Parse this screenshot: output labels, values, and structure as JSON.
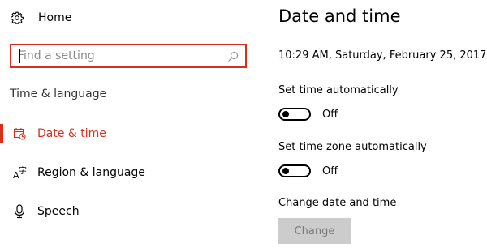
{
  "nav": {
    "home_label": "Home",
    "search": {
      "value": "",
      "placeholder": "Find a setting"
    },
    "section_title": "Time & language",
    "items": [
      {
        "label": "Date & time",
        "icon": "calendar-clock-icon",
        "active": true
      },
      {
        "label": "Region & language",
        "icon": "language-icon",
        "active": false
      },
      {
        "label": "Speech",
        "icon": "microphone-icon",
        "active": false
      }
    ]
  },
  "main": {
    "title": "Date and time",
    "current_datetime": "10:29 AM, Saturday, February 25, 2017",
    "set_time_auto": {
      "label": "Set time automatically",
      "state": "Off"
    },
    "set_timezone_auto": {
      "label": "Set time zone automatically",
      "state": "Off"
    },
    "change_section": {
      "label": "Change date and time",
      "button_label": "Change"
    }
  },
  "colors": {
    "accent": "#d2311f",
    "disabled_button_bg": "#cccccc",
    "disabled_button_text": "#7a7a7a"
  }
}
